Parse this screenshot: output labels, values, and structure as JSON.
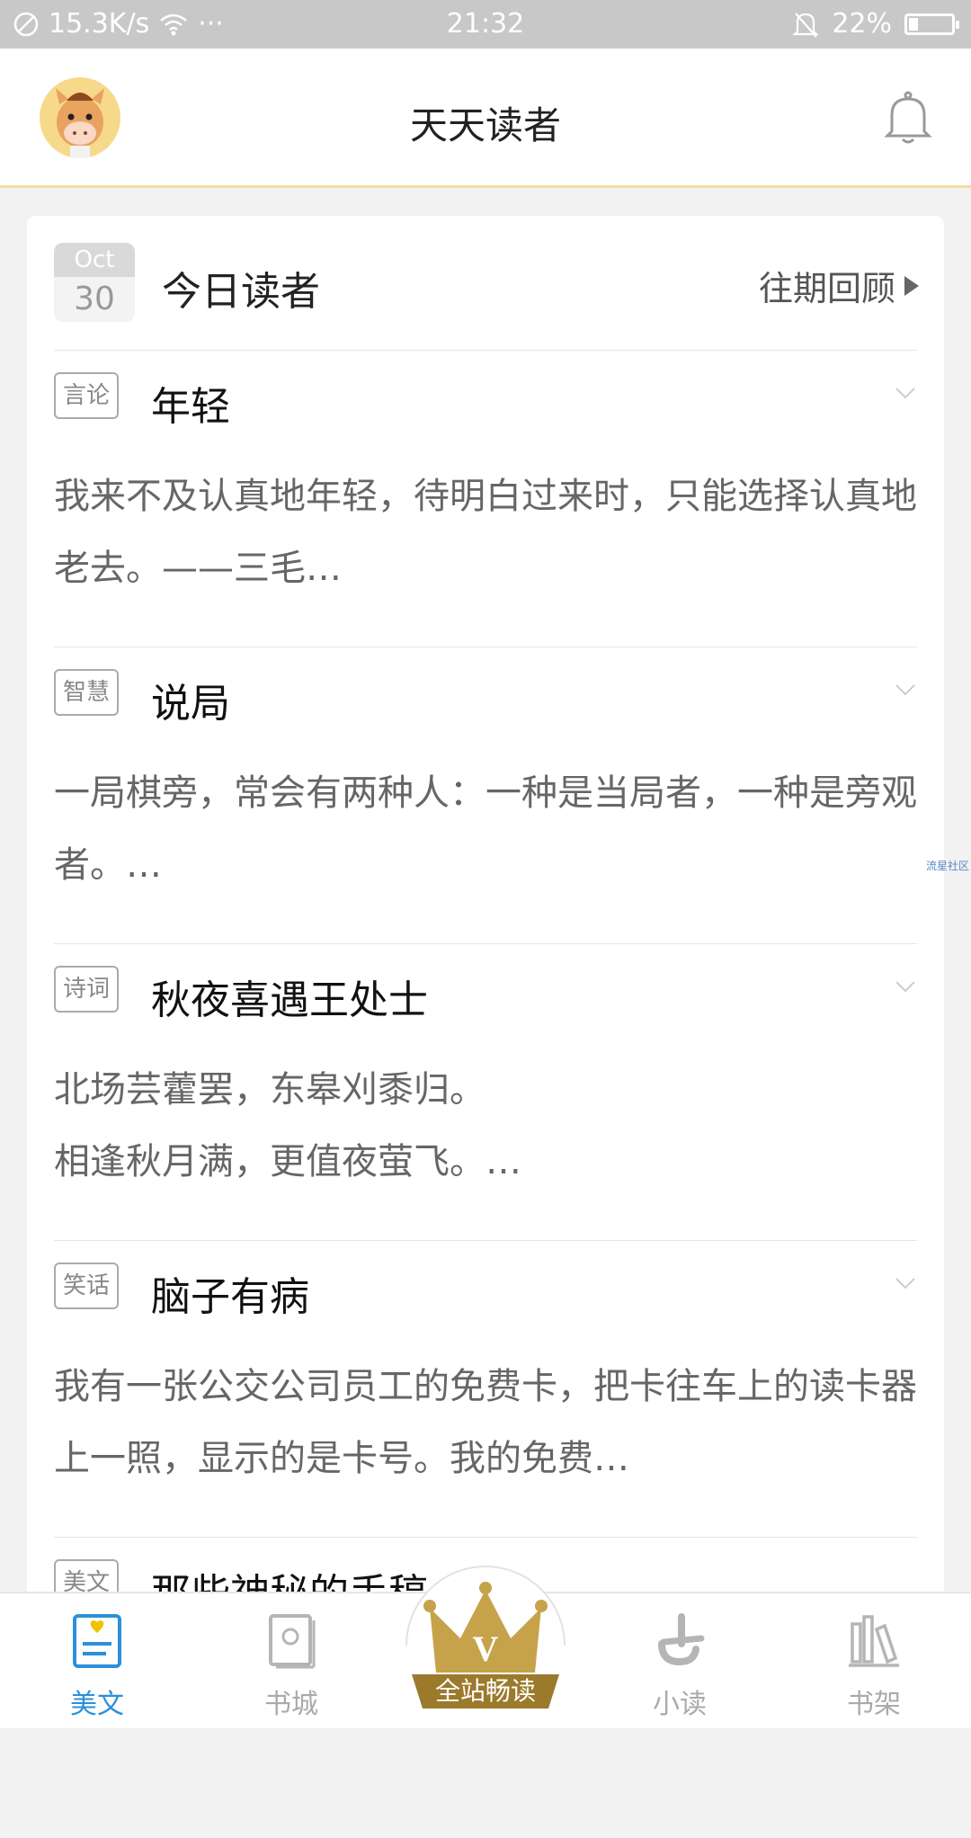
{
  "status_bar": {
    "speed": "15.3K/s",
    "dots": "···",
    "time": "21:32",
    "battery": "22%"
  },
  "battery_level": 0.22,
  "header": {
    "title": "天天读者"
  },
  "today": {
    "month": "Oct",
    "day": "30",
    "title": "今日读者",
    "past_review": "往期回顾"
  },
  "articles": [
    {
      "tag": "言论",
      "title": "年轻",
      "excerpt": "我来不及认真地年轻，待明白过来时，只能选择认真地老去。——三毛…"
    },
    {
      "tag": "智慧",
      "title": "说局",
      "excerpt": "一局棋旁，常会有两种人：一种是当局者，一种是旁观者。…"
    },
    {
      "tag": "诗词",
      "title": "秋夜喜遇王处士",
      "excerpt_lines": [
        "北场芸藿罢，东皋刈黍归。",
        "相逢秋月满，更值夜萤飞。…"
      ]
    },
    {
      "tag": "笑话",
      "title": "脑子有病",
      "excerpt": "我有一张公交公司员工的免费卡，把卡往车上的读卡器上一照，显示的是卡号。我的免费…"
    },
    {
      "tag": "美文",
      "title": "那些神秘的手稿"
    }
  ],
  "side_text": "流星社区",
  "nav": {
    "meiwen": "美文",
    "shucheng": "书城",
    "vip_label": "全站畅读",
    "crown_letter": "V",
    "xiaodu": "小读",
    "shujia": "书架"
  },
  "colors": {
    "accent": "#2b90d9",
    "header_border": "#f3e0a0",
    "crown_gold": "#c6a24a"
  }
}
